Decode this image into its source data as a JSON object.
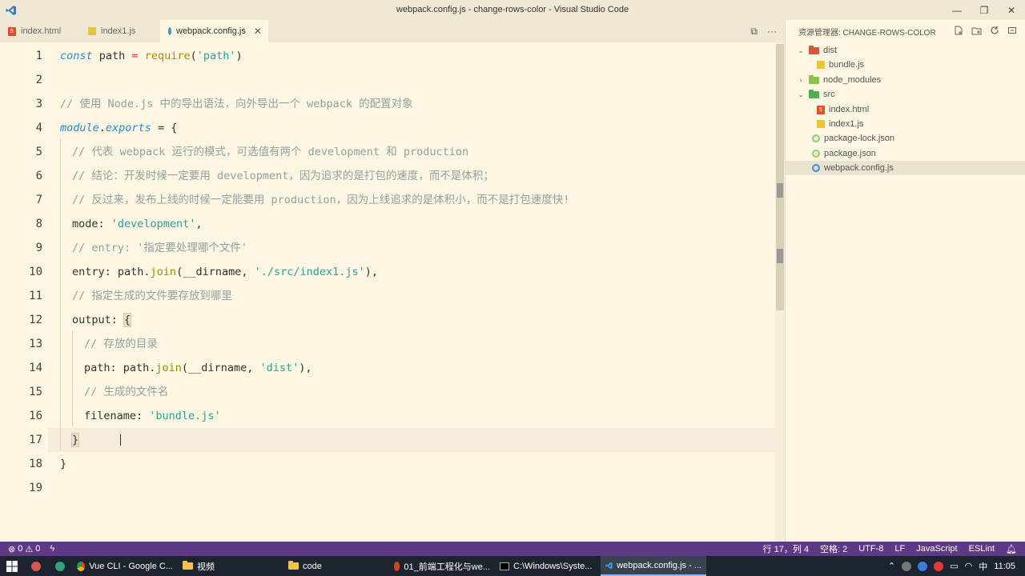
{
  "window": {
    "title": "webpack.config.js - change-rows-color - Visual Studio Code",
    "controls": [
      "—",
      "❐",
      "✕"
    ]
  },
  "tabs": [
    {
      "label": "index.html",
      "icon": "html-file-icon"
    },
    {
      "label": "index1.js",
      "icon": "js-file-icon"
    },
    {
      "label": "webpack.config.js",
      "icon": "webpack-file-icon",
      "active": true,
      "close": "✕"
    }
  ],
  "tab_actions": [
    "⧉",
    "···"
  ],
  "editor": {
    "line_numbers": [
      "1",
      "2",
      "3",
      "4",
      "5",
      "6",
      "7",
      "8",
      "9",
      "10",
      "11",
      "12",
      "13",
      "14",
      "15",
      "16",
      "17",
      "18",
      "19"
    ],
    "lines": {
      "l1": {
        "a": "const",
        "b": " path ",
        "c": "=",
        "d": " require",
        "e": "(",
        "f": "'path'",
        "g": ")"
      },
      "l3": "// 使用 Node.js 中的导出语法，向外导出一个 webpack 的配置对象",
      "l4": {
        "a": "module",
        "b": ".",
        "c": "exports",
        "d": " = {"
      },
      "l5": "// 代表 webpack 运行的模式，可选值有两个 development 和 production",
      "l6": "// 结论：开发时候一定要用 development，因为追求的是打包的速度，而不是体积；",
      "l7": "// 反过来，发布上线的时候一定能要用 production，因为上线追求的是体积小，而不是打包速度快!",
      "l8": {
        "a": "mode: ",
        "b": "'development'",
        "c": ","
      },
      "l9": "// entry: '指定要处理哪个文件'",
      "l10": {
        "a": "entry: path.",
        "b": "join",
        "c": "(__dirname, ",
        "d": "'./src/index1.js'",
        "e": "),"
      },
      "l11": "// 指定生成的文件要存放到哪里",
      "l12": {
        "a": "output: ",
        "b": "{"
      },
      "l13": "// 存放的目录",
      "l14": {
        "a": "path: path.",
        "b": "join",
        "c": "(__dirname, ",
        "d": "'dist'",
        "e": "),"
      },
      "l15": "// 生成的文件名",
      "l16": {
        "a": "filename: ",
        "b": "'bundle.js'"
      },
      "l17": "}",
      "l18": "}"
    }
  },
  "explorer": {
    "header": "资源管理器: CHANGE-ROWS-COLOR",
    "actions": [
      "new-file-icon",
      "new-folder-icon",
      "refresh-icon",
      "collapse-icon"
    ],
    "items": [
      {
        "label": "dist",
        "type": "folder-open",
        "color": "#e0533b"
      },
      {
        "label": "bundle.js",
        "type": "js"
      },
      {
        "label": "node_modules",
        "type": "folder-closed",
        "color": "#8bc34a"
      },
      {
        "label": "src",
        "type": "folder-open",
        "color": "#4caf50"
      },
      {
        "label": "index.html",
        "type": "html"
      },
      {
        "label": "index1.js",
        "type": "js"
      },
      {
        "label": "package-lock.json",
        "type": "pkg"
      },
      {
        "label": "package.json",
        "type": "pkg"
      },
      {
        "label": "webpack.config.js",
        "type": "webpack",
        "selected": true
      }
    ]
  },
  "statusbar": {
    "errors": "0",
    "warnings": "0",
    "position": "行 17，列 4",
    "spaces": "空格: 2",
    "encoding": "UTF-8",
    "eol": "LF",
    "language": "JavaScript",
    "extra": "ESLint",
    "color": "#5e3a86"
  },
  "taskbar": {
    "apps": [
      {
        "label": "Vue CLI - Google C...",
        "icon": "chrome-icon"
      },
      {
        "label": "视频",
        "icon": "folder-icon"
      },
      {
        "label": "code",
        "icon": "folder-icon"
      },
      {
        "label": "01_前端工程化与we...",
        "icon": "powerpoint-icon"
      },
      {
        "label": "C:\\Windows\\Syste...",
        "icon": "cmd-icon"
      },
      {
        "label": "webpack.config.js - ...",
        "icon": "vscode-icon",
        "active": true
      }
    ],
    "ime": "中",
    "time": "11:05"
  }
}
